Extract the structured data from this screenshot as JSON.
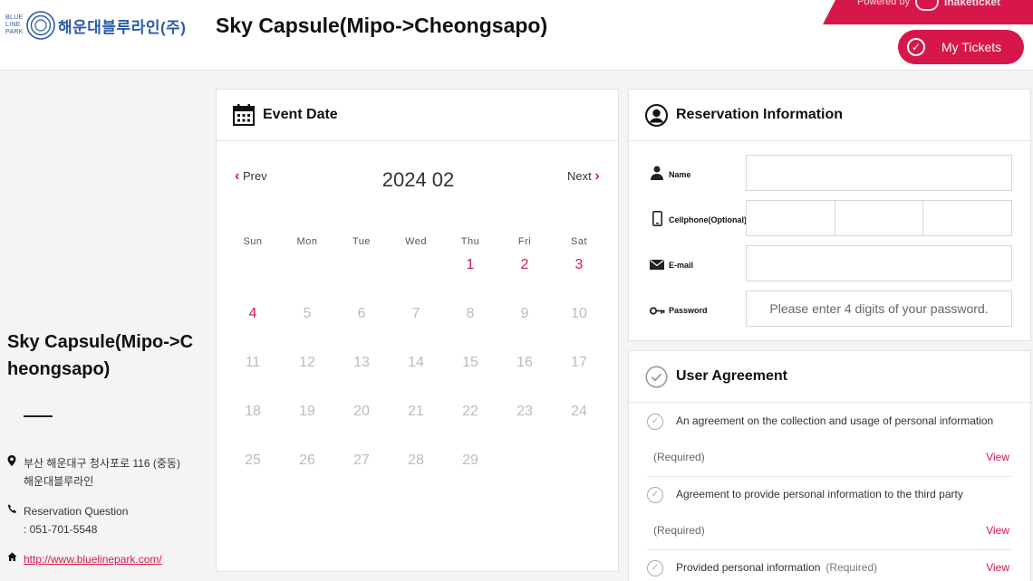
{
  "header": {
    "logo_small": [
      "BLUE",
      "LINE",
      "PARK"
    ],
    "logo_name": "해운대블루라인(주)",
    "page_title": "Sky Capsule(Mipo->Cheongsapo)",
    "powered_by": "Powered by",
    "powered_brand": "Inaketicket",
    "my_tickets": "My Tickets"
  },
  "product": {
    "title": "Sky Capsule(Mipo->Cheongsapo)",
    "address_line1": "부산 해운대구 청사포로 116 (중동)",
    "address_line2": "해운대블루라인",
    "question_label": "Reservation Question",
    "question_phone": ": 051-701-5548",
    "homepage": "http://www.bluelinepark.com/"
  },
  "calendar": {
    "title": "Event Date",
    "prev": "Prev",
    "next": "Next",
    "month": "2024 02",
    "weekdays": [
      "Sun",
      "Mon",
      "Tue",
      "Wed",
      "Thu",
      "Fri",
      "Sat"
    ],
    "weeks": [
      [
        "",
        "",
        "",
        "",
        "1",
        "2",
        "3"
      ],
      [
        "4",
        "5",
        "6",
        "7",
        "8",
        "9",
        "10"
      ],
      [
        "11",
        "12",
        "13",
        "14",
        "15",
        "16",
        "17"
      ],
      [
        "18",
        "19",
        "20",
        "21",
        "22",
        "23",
        "24"
      ],
      [
        "25",
        "26",
        "27",
        "28",
        "29",
        "",
        ""
      ]
    ],
    "available_days": [
      "1",
      "2",
      "3",
      "4"
    ]
  },
  "reservation": {
    "title": "Reservation Information",
    "name_label": "Name",
    "name_value": "",
    "phone_label": "Cellphone(Optional)",
    "phone_parts": [
      "",
      "",
      ""
    ],
    "email_label": "E-mail",
    "email_value": "",
    "password_label": "Password",
    "password_placeholder": "Please enter 4 digits of your password."
  },
  "agreement": {
    "title": "User Agreement",
    "items": [
      {
        "text": "An agreement on the collection and usage of personal information",
        "required": "(Required)",
        "view": "View"
      },
      {
        "text": "Agreement to provide personal information to the third party",
        "required": "(Required)",
        "view": "View"
      },
      {
        "text": "Provided personal information",
        "required": "(Required)",
        "view": "View"
      }
    ]
  },
  "colors": {
    "accent": "#d7174a",
    "brand": "#2b5aa6"
  }
}
